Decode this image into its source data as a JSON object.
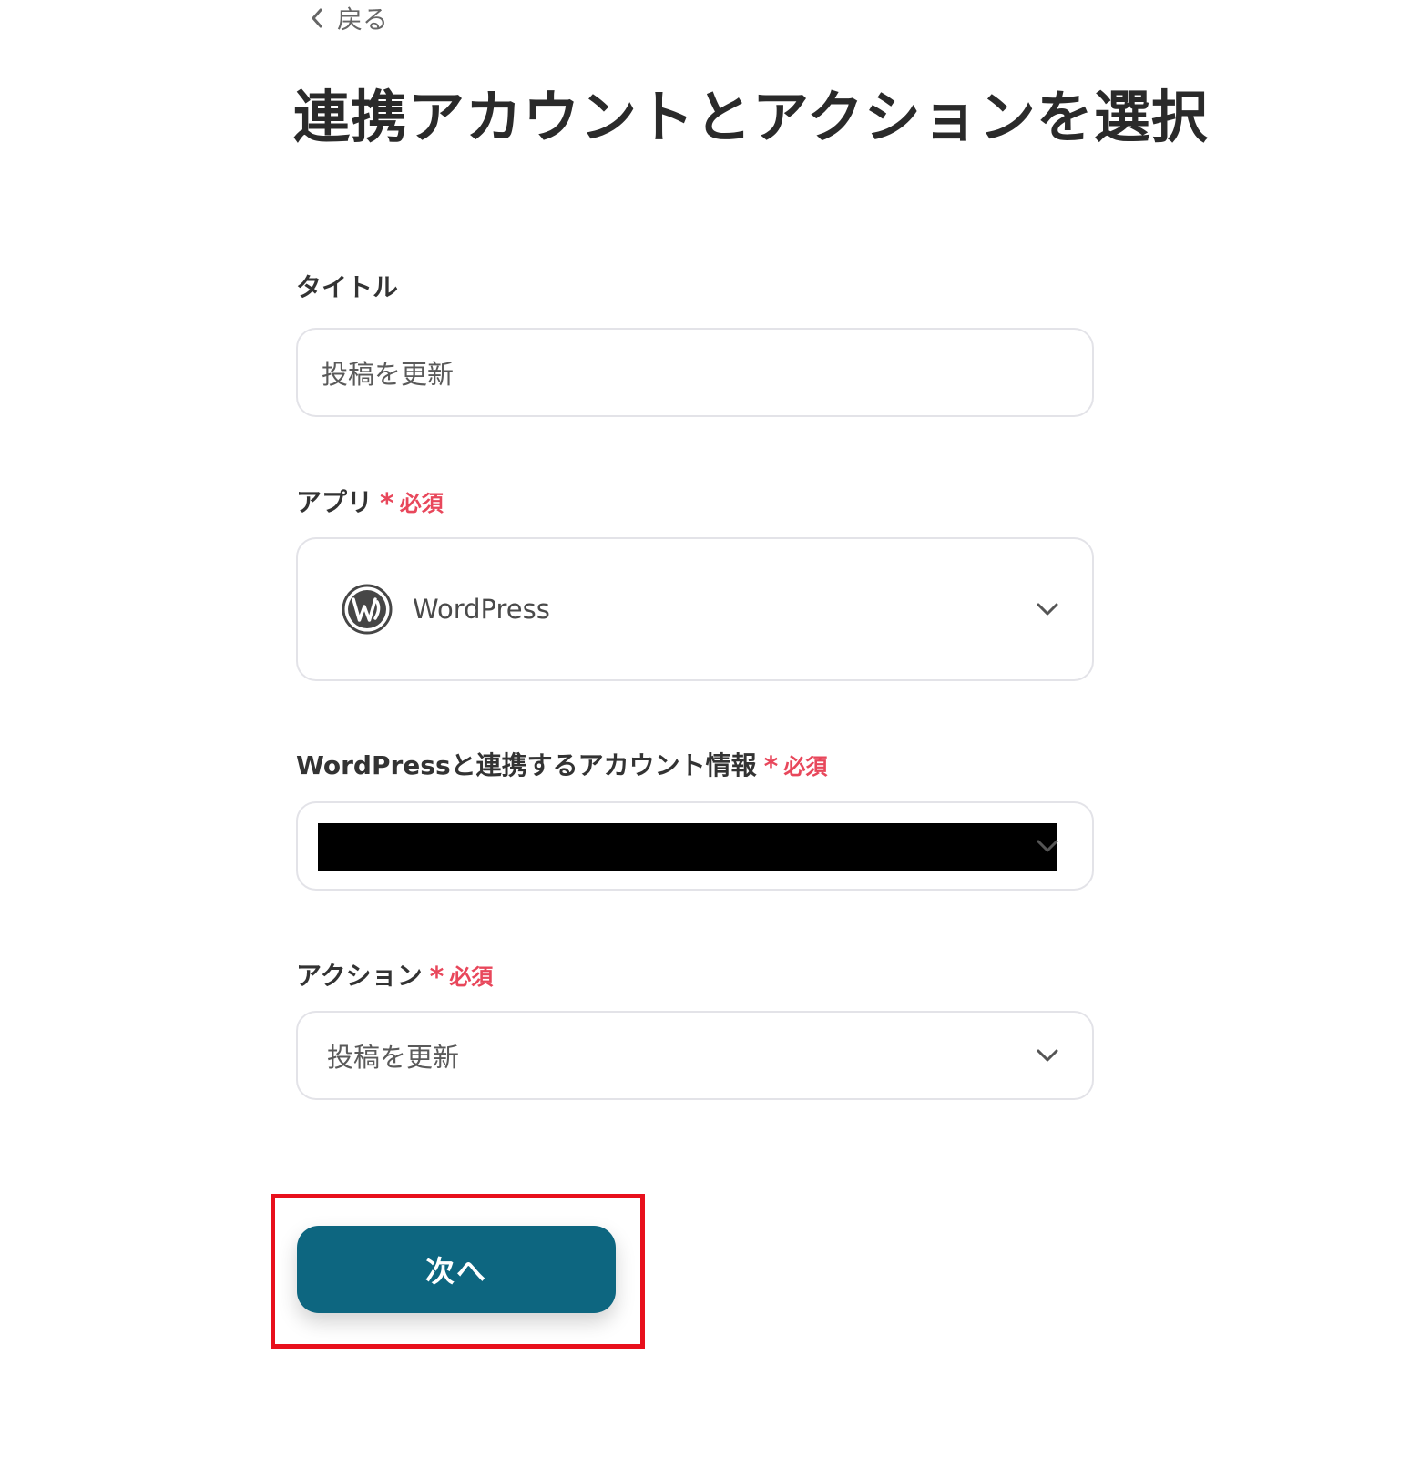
{
  "back": {
    "label": "戻る"
  },
  "page": {
    "title": "連携アカウントとアクションを選択"
  },
  "form": {
    "required_label": "必須",
    "title_field": {
      "label": "タイトル",
      "value": "投稿を更新"
    },
    "app_field": {
      "label": "アプリ",
      "value": "WordPress",
      "icon": "wordpress-logo-icon"
    },
    "account_field": {
      "label": "WordPressと連携するアカウント情報",
      "value_redacted": true
    },
    "action_field": {
      "label": "アクション",
      "value": "投稿を更新"
    }
  },
  "actions": {
    "next_label": "次へ"
  },
  "colors": {
    "primary": "#0d6680",
    "required": "#e8475b",
    "highlight": "#e8101c",
    "border": "#e3e3e8"
  }
}
